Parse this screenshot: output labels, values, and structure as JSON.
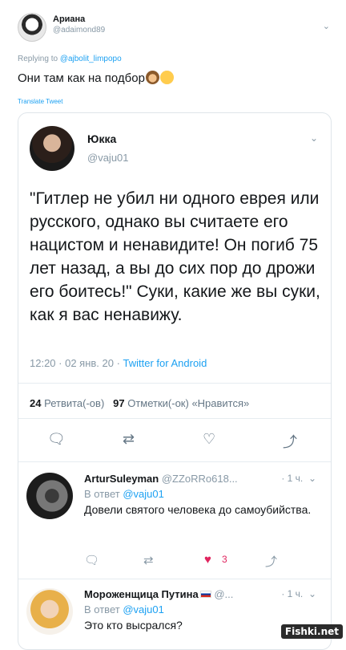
{
  "outer_tweet": {
    "name": "Ариана",
    "handle": "@adaimond89",
    "replying_prefix": "Replying to",
    "replying_to": "@ajbolit_limpopo",
    "text": "Они там как на подбор",
    "translate": "Translate Tweet",
    "chevron": "⌄"
  },
  "main_tweet": {
    "name": "Юкка",
    "handle": "@vaju01",
    "chevron": "⌄",
    "text": "\"Гитлер не убил ни одного еврея или русского, однако вы считаете его нацистом и ненавидите! Он погиб 75 лет назад, а вы до сих пор до дрожи его боитесь!\" Суки, какие же вы суки, как я вас ненавижу.",
    "time": "12:20 · 02 янв. 20 ·",
    "source": "Twitter for Android",
    "retweets_count": "24",
    "retweets_label": "Ретвита(-ов)",
    "likes_count": "97",
    "likes_label": "Отметки(-ок) «Нравится»"
  },
  "replies": [
    {
      "name": "ArturSuleyman",
      "handle": "@ZZoRRo618...",
      "time": "· 1 ч.",
      "reply_prefix": "В ответ",
      "reply_to": "@vaju01",
      "text": "Довели святого человека до самоубийства.",
      "likes": "3"
    },
    {
      "name": "Мороженщица Путина",
      "handle": "@...",
      "time": "· 1 ч.",
      "reply_prefix": "В ответ",
      "reply_to": "@vaju01",
      "text": "Это кто высрался?"
    }
  ],
  "watermark": "Fishki.net",
  "colors": {
    "accent": "#1da1f2",
    "like": "#e0245e",
    "muted": "#8899a6"
  },
  "icons": [
    "reply-icon",
    "retweet-icon",
    "like-icon",
    "share-icon",
    "chevron-down-icon",
    "russia-flag-icon"
  ]
}
